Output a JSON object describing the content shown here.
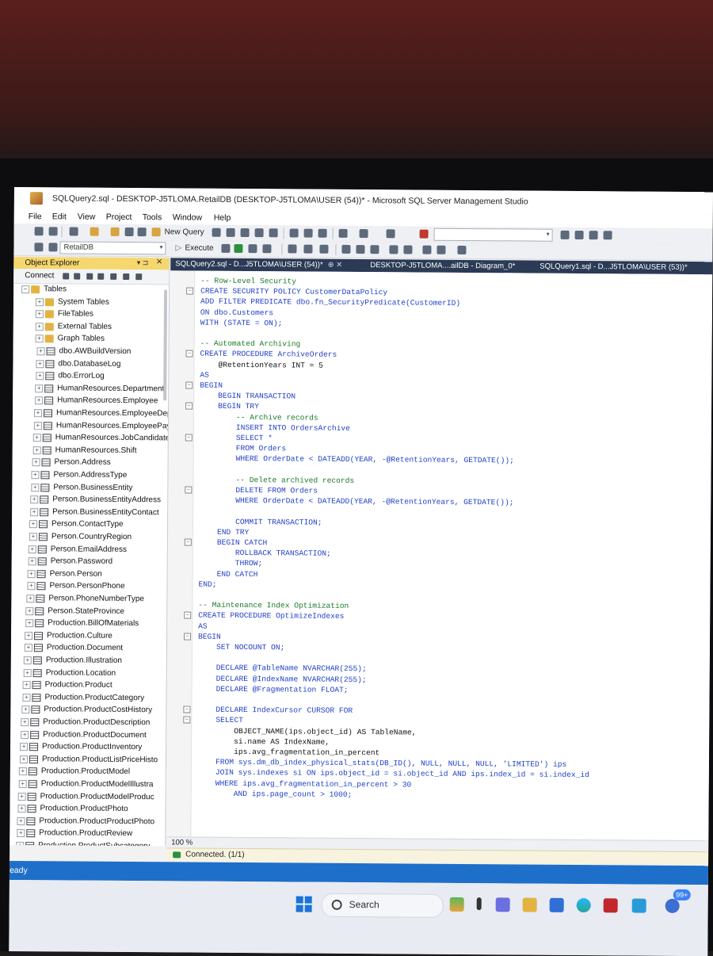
{
  "window": {
    "title": "SQLQuery2.sql - DESKTOP-J5TLOMA.RetailDB (DESKTOP-J5TLOMA\\USER (54))* - Microsoft SQL Server Management Studio"
  },
  "menu": [
    "File",
    "Edit",
    "View",
    "Project",
    "Tools",
    "Window",
    "Help"
  ],
  "toolbar": {
    "new_query": "New Query",
    "database": "RetailDB",
    "execute": "Execute"
  },
  "object_explorer": {
    "title": "Object Explorer",
    "connect": "Connect",
    "tree": [
      "Tables",
      "System Tables",
      "FileTables",
      "External Tables",
      "Graph Tables",
      "dbo.AWBuildVersion",
      "dbo.DatabaseLog",
      "dbo.ErrorLog",
      "HumanResources.Department",
      "HumanResources.Employee",
      "HumanResources.EmployeeDepa",
      "HumanResources.EmployeePayH",
      "HumanResources.JobCandidate",
      "HumanResources.Shift",
      "Person.Address",
      "Person.AddressType",
      "Person.BusinessEntity",
      "Person.BusinessEntityAddress",
      "Person.BusinessEntityContact",
      "Person.ContactType",
      "Person.CountryRegion",
      "Person.EmailAddress",
      "Person.Password",
      "Person.Person",
      "Person.PersonPhone",
      "Person.PhoneNumberType",
      "Person.StateProvince",
      "Production.BillOfMaterials",
      "Production.Culture",
      "Production.Document",
      "Production.Illustration",
      "Production.Location",
      "Production.Product",
      "Production.ProductCategory",
      "Production.ProductCostHistory",
      "Production.ProductDescription",
      "Production.ProductDocument",
      "Production.ProductInventory",
      "Production.ProductListPriceHisto",
      "Production.ProductModel",
      "Production.ProductModelIllustra",
      "Production.ProductModelProduc",
      "Production.ProductPhoto",
      "Production.ProductProductPhoto",
      "Production.ProductReview",
      "Production.ProductSubcategory"
    ]
  },
  "tabs": [
    "SQLQuery2.sql - D...J5TLOMA\\USER (54))*",
    "DESKTOP-J5TLOMA....ailDB - Diagram_0*",
    "SQLQuery1.sql - D...J5TLOMA\\USER (53))*"
  ],
  "code": [
    "-- Row-Level Security",
    "CREATE SECURITY POLICY CustomerDataPolicy",
    "ADD FILTER PREDICATE dbo.fn_SecurityPredicate(CustomerID)",
    "ON dbo.Customers",
    "WITH (STATE = ON);",
    "",
    "-- Automated Archiving",
    "CREATE PROCEDURE ArchiveOrders",
    "    @RetentionYears INT = 5",
    "AS",
    "BEGIN",
    "    BEGIN TRANSACTION",
    "    BEGIN TRY",
    "        -- Archive records",
    "        INSERT INTO OrdersArchive",
    "        SELECT *",
    "        FROM Orders",
    "        WHERE OrderDate < DATEADD(YEAR, -@RetentionYears, GETDATE());",
    "",
    "        -- Delete archived records",
    "        DELETE FROM Orders",
    "        WHERE OrderDate < DATEADD(YEAR, -@RetentionYears, GETDATE());",
    "",
    "        COMMIT TRANSACTION;",
    "    END TRY",
    "    BEGIN CATCH",
    "        ROLLBACK TRANSACTION;",
    "        THROW;",
    "    END CATCH",
    "END;",
    "",
    "-- Maintenance Index Optimization",
    "CREATE PROCEDURE OptimizeIndexes",
    "AS",
    "BEGIN",
    "    SET NOCOUNT ON;",
    "",
    "    DECLARE @TableName NVARCHAR(255);",
    "    DECLARE @IndexName NVARCHAR(255);",
    "    DECLARE @Fragmentation FLOAT;",
    "",
    "    DECLARE IndexCursor CURSOR FOR",
    "    SELECT",
    "        OBJECT_NAME(ips.object_id) AS TableName,",
    "        si.name AS IndexName,",
    "        ips.avg_fragmentation_in_percent",
    "    FROM sys.dm_db_index_physical_stats(DB_ID(), NULL, NULL, NULL, 'LIMITED') ips",
    "    JOIN sys.indexes si ON ips.object_id = si.object_id AND ips.index_id = si.index_id",
    "    WHERE ips.avg_fragmentation_in_percent > 30",
    "        AND ips.page_count > 1000;"
  ],
  "editor": {
    "zoom": "100 %"
  },
  "connection_status": "Connected. (1/1)",
  "status": "eady",
  "taskbar": {
    "search_placeholder": "Search",
    "badge": "99+"
  }
}
